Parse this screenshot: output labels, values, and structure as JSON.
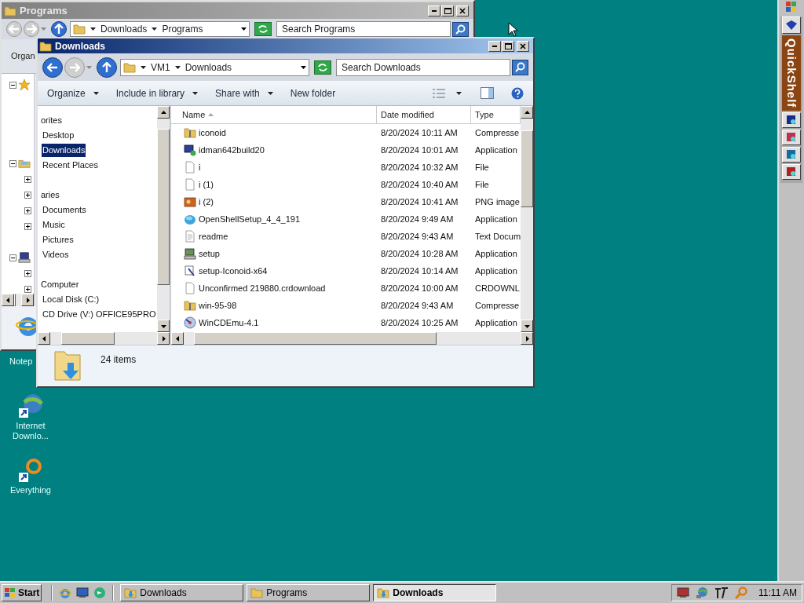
{
  "programs_window": {
    "title": "Programs",
    "nav": {
      "back_enabled": false,
      "forward_enabled": false
    },
    "address": [
      "Downloads",
      "Programs"
    ],
    "search": {
      "placeholder": "Search Programs"
    },
    "toolbar": [
      "Organ"
    ],
    "tree": [
      {
        "kind": "favorites",
        "expanded": true,
        "children": [
          {
            "kind": "leaf"
          },
          {
            "kind": "leaf"
          },
          {
            "kind": "leaf"
          },
          {
            "kind": "leaf"
          }
        ]
      },
      {
        "kind": "libraries",
        "expanded": true,
        "children": [
          {
            "kind": "node",
            "expanded": false
          },
          {
            "kind": "node",
            "expanded": false
          },
          {
            "kind": "node",
            "expanded": false
          },
          {
            "kind": "node",
            "expanded": false
          },
          {
            "kind": "leaf"
          }
        ]
      },
      {
        "kind": "computer",
        "expanded": true,
        "children": [
          {
            "kind": "node",
            "expanded": false
          },
          {
            "kind": "node",
            "expanded": false
          }
        ]
      }
    ]
  },
  "downloads_window": {
    "title": "Downloads",
    "nav": {
      "back_enabled": true,
      "forward_enabled": false
    },
    "address": [
      "VM1",
      "Downloads"
    ],
    "search": {
      "placeholder": "Search Downloads"
    },
    "commands": [
      {
        "label": "Organize",
        "menu": true
      },
      {
        "label": "Include in library",
        "menu": true
      },
      {
        "label": "Share with",
        "menu": true
      },
      {
        "label": "New folder",
        "menu": false
      }
    ],
    "nav_items": [
      {
        "label": "orites",
        "kind": "header",
        "selected": false
      },
      {
        "label": "Desktop",
        "kind": "item",
        "selected": false
      },
      {
        "label": "Downloads",
        "kind": "item",
        "selected": true
      },
      {
        "label": "Recent Places",
        "kind": "item",
        "selected": false
      },
      {
        "label": "aries",
        "kind": "header",
        "selected": false
      },
      {
        "label": "Documents",
        "kind": "item",
        "selected": false
      },
      {
        "label": "Music",
        "kind": "item",
        "selected": false
      },
      {
        "label": "Pictures",
        "kind": "item",
        "selected": false
      },
      {
        "label": "Videos",
        "kind": "item",
        "selected": false
      },
      {
        "label": "Computer",
        "kind": "header",
        "selected": false
      },
      {
        "label": "Local Disk (C:)",
        "kind": "item",
        "selected": false
      },
      {
        "label": "CD Drive (V:) OFFICE95PRO",
        "kind": "item",
        "selected": false
      }
    ],
    "columns": [
      {
        "label": "Name",
        "sorted": true
      },
      {
        "label": "Date modified",
        "sorted": false
      },
      {
        "label": "Type",
        "sorted": false
      }
    ],
    "files": [
      {
        "name": "iconoid",
        "date": "8/20/2024 10:11 AM",
        "type": "Compresse",
        "kind": "zip"
      },
      {
        "name": "idman642build20",
        "date": "8/20/2024 10:01 AM",
        "type": "Application",
        "kind": "app"
      },
      {
        "name": "i",
        "date": "8/20/2024 10:32 AM",
        "type": "File",
        "kind": "file"
      },
      {
        "name": "i (1)",
        "date": "8/20/2024 10:40 AM",
        "type": "File",
        "kind": "file"
      },
      {
        "name": "i (2)",
        "date": "8/20/2024 10:41 AM",
        "type": "PNG image",
        "kind": "image"
      },
      {
        "name": "OpenShellSetup_4_4_191",
        "date": "8/20/2024 9:49 AM",
        "type": "Application",
        "kind": "shell"
      },
      {
        "name": "readme",
        "date": "8/20/2024 9:43 AM",
        "type": "Text Docum",
        "kind": "text"
      },
      {
        "name": "setup",
        "date": "8/20/2024 10:28 AM",
        "type": "Application",
        "kind": "setup"
      },
      {
        "name": "setup-Iconoid-x64",
        "date": "8/20/2024 10:14 AM",
        "type": "Application",
        "kind": "installer"
      },
      {
        "name": "Unconfirmed 219880.crdownload",
        "date": "8/20/2024 10:00 AM",
        "type": "CRDOWNL",
        "kind": "file"
      },
      {
        "name": "win-95-98",
        "date": "8/20/2024 9:43 AM",
        "type": "Compresse",
        "kind": "zip"
      },
      {
        "name": "WinCDEmu-4.1",
        "date": "8/20/2024 10:25 AM",
        "type": "Application",
        "kind": "cd"
      }
    ],
    "status": "24 items"
  },
  "desktop_icons": [
    {
      "label": "Notep",
      "kind": "notepad"
    },
    {
      "label": "Internet Downlo...",
      "kind": "globe"
    },
    {
      "label": "Everything",
      "kind": "ring"
    }
  ],
  "quickshelf": {
    "title": "QuickShelf"
  },
  "taskbar": {
    "start": "Start",
    "tasks": [
      {
        "label": "Downloads",
        "kind": "downloads",
        "selected": false
      },
      {
        "label": "Programs",
        "kind": "folder",
        "selected": false
      },
      {
        "label": "Downloads",
        "kind": "downloads",
        "selected": true
      }
    ],
    "clock": "11:11 AM"
  }
}
